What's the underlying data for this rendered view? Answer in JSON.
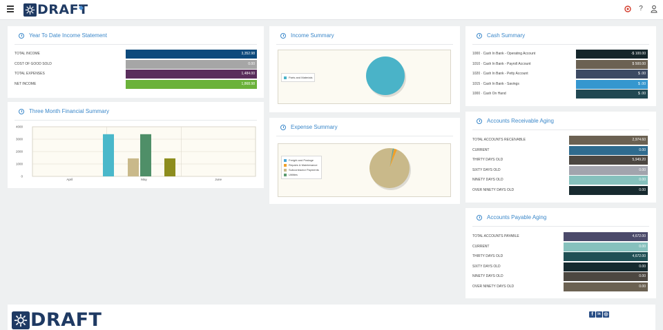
{
  "header": {
    "logo_text": "DRAFT",
    "help_glyph": "?",
    "icons": [
      "menu-icon",
      "notification-icon",
      "help-icon",
      "user-icon"
    ]
  },
  "ytd": {
    "title": "Year To Date Income Statement",
    "rows": [
      {
        "label": "TOTAL INCOME",
        "value": "3,352.98",
        "color": "#0d4a7c"
      },
      {
        "label": "COST OF GOOD SOLD",
        "value": "0.00",
        "color": "#a6a6a6"
      },
      {
        "label": "TOTAL EXPENSES",
        "value": "1,484.00",
        "color": "#5a2e5c"
      },
      {
        "label": "NET INCOME",
        "value": "1,868.98",
        "color": "#6bb23a"
      }
    ]
  },
  "three_month": {
    "title": "Three Month Financial Summary"
  },
  "chart_data": [
    {
      "type": "bar",
      "categories": [
        "April",
        "May",
        "June"
      ],
      "series": [
        {
          "values": [
            0,
            3400,
            0
          ],
          "color": "#4ab8ca"
        },
        {
          "values": [
            0,
            1450,
            0
          ],
          "color": "#c9b98a"
        },
        {
          "values": [
            0,
            3400,
            0
          ],
          "color": "#4f8f68"
        },
        {
          "values": [
            0,
            1450,
            0
          ],
          "color": "#8d8d1e"
        }
      ],
      "yticks": [
        "0",
        "1000",
        "2000",
        "3000",
        "4000"
      ],
      "ylim": [
        0,
        4000
      ],
      "grid": true
    },
    {
      "type": "pie",
      "title": "Income Summary",
      "labels": [
        "Parts and Materials"
      ],
      "values": [
        100
      ],
      "colors": [
        "#4ab3c8"
      ],
      "legend": "left"
    },
    {
      "type": "pie",
      "title": "Expense Summary",
      "labels": [
        "Freight and Postage",
        "Repairs & Maintenance",
        "Subcontractor Payments",
        "Utilities"
      ],
      "values": [
        0.5,
        2.5,
        96.5,
        0.5
      ],
      "colors": [
        "#4aa6d6",
        "#f0a02a",
        "#c9b98a",
        "#5b9a6e"
      ],
      "legend": "left"
    }
  ],
  "cash": {
    "title": "Cash Summary",
    "rows": [
      {
        "label": "1000 · Cash In Bank - Operating Account",
        "value": "-$ 100.00",
        "color": "#15262b"
      },
      {
        "label": "1010 · Cash In Bank - Payroll Account",
        "value": "$ 500.00",
        "color": "#6b6152"
      },
      {
        "label": "1020 · Cash In Bank - Petty Account",
        "value": "$ .00",
        "color": "#3c4a63"
      },
      {
        "label": "1015 · Cash In Bank - Savings",
        "value": "$ .00",
        "color": "#3597cf"
      },
      {
        "label": "1000 · Cash On Hand",
        "value": "$ .00",
        "color": "#214852"
      }
    ]
  },
  "ar": {
    "title": "Accounts Receivable Aging",
    "rows": [
      {
        "label": "TOTAL ACCOUNTS RECEIVABLE",
        "value": "2,974.60",
        "color": "#6b6152"
      },
      {
        "label": "CURRENT",
        "value": "0.00",
        "color": "#2f6b8e"
      },
      {
        "label": "THIRTY DAYS OLD",
        "value": "5,949.20",
        "color": "#4c4741"
      },
      {
        "label": "SIXTY DAYS OLD",
        "value": "0.00",
        "color": "#a2a4ad"
      },
      {
        "label": "NINETY DAYS OLD",
        "value": "0.00",
        "color": "#86c1bd"
      },
      {
        "label": "OVER NINETY DAYS OLD",
        "value": "0.00",
        "color": "#172a2f"
      }
    ]
  },
  "ap": {
    "title": "Accounts Payable Aging",
    "rows": [
      {
        "label": "TOTAL ACCOUNTS PAYABLE",
        "value": "4,672.00",
        "color": "#4b4a6a"
      },
      {
        "label": "CURRENT",
        "value": "0.00",
        "color": "#86c1bd"
      },
      {
        "label": "THIRTY DAYS OLD",
        "value": "4,672.00",
        "color": "#1f5055"
      },
      {
        "label": "SIXTY DAYS OLD",
        "value": "0.00",
        "color": "#152a2f"
      },
      {
        "label": "NINETY DAYS OLD",
        "value": "0.00",
        "color": "#4c4741"
      },
      {
        "label": "OVER NINETY DAYS OLD",
        "value": "0.00",
        "color": "#6b6152"
      }
    ]
  },
  "footer": {
    "logo_text": "DRAFT",
    "social": [
      "f",
      "in",
      "◎"
    ]
  }
}
